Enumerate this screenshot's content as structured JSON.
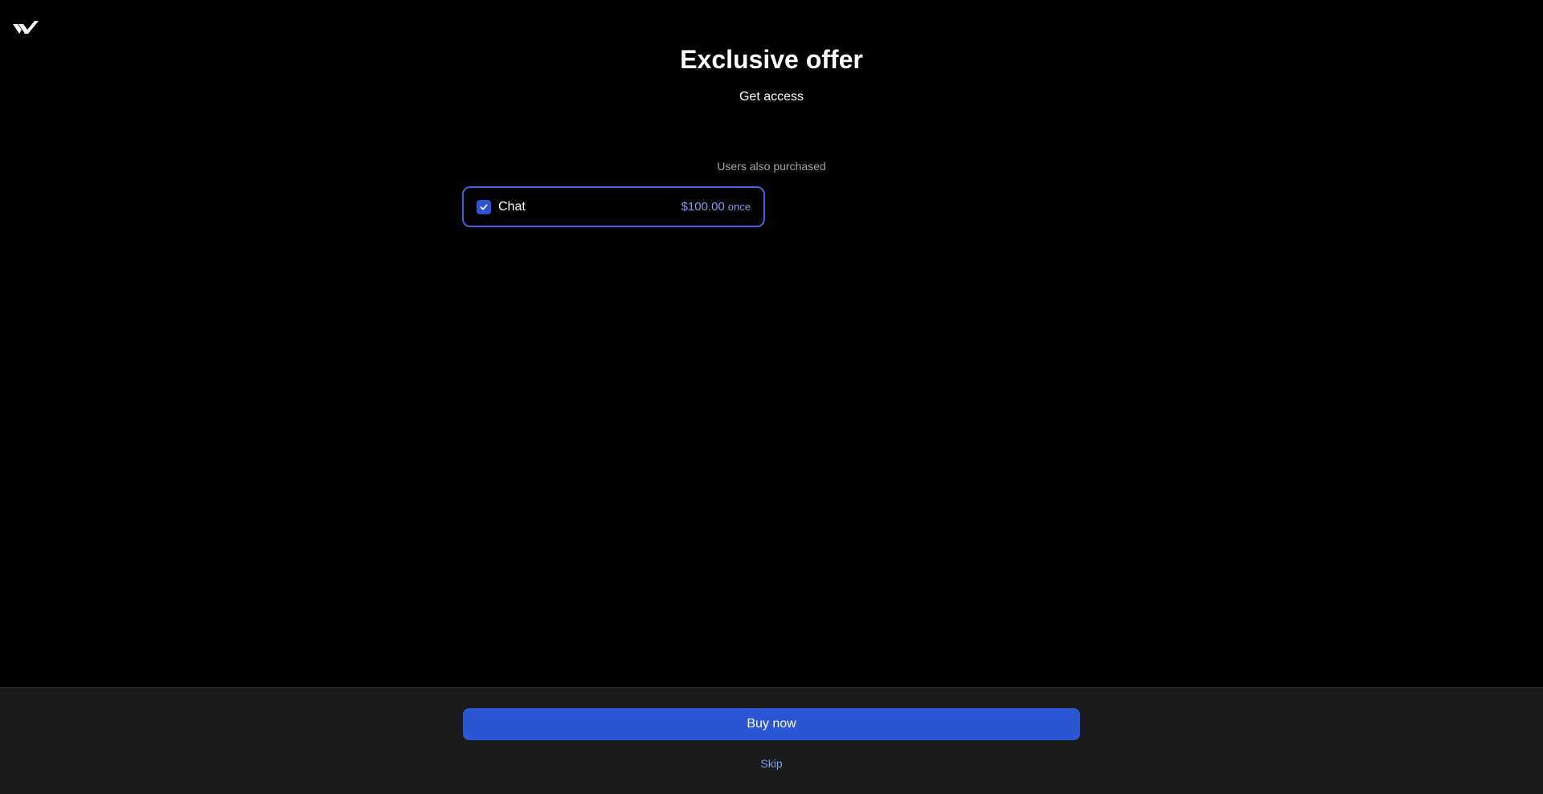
{
  "header": {
    "logo_icon": "brand-logo-icon"
  },
  "hero": {
    "title": "Exclusive offer",
    "subtitle": "Get access"
  },
  "upsell": {
    "section_label": "Users also purchased",
    "items": [
      {
        "name": "Chat",
        "price": "$100.00",
        "period": "once",
        "checked": true
      }
    ]
  },
  "footer": {
    "buy_label": "Buy now",
    "skip_label": "Skip"
  },
  "colors": {
    "background": "#000000",
    "footer_background": "#1b1b1b",
    "accent": "#2c55d4",
    "card_border": "#3f63db",
    "link": "#7f9cf5",
    "muted_text": "#a3a3a3"
  }
}
